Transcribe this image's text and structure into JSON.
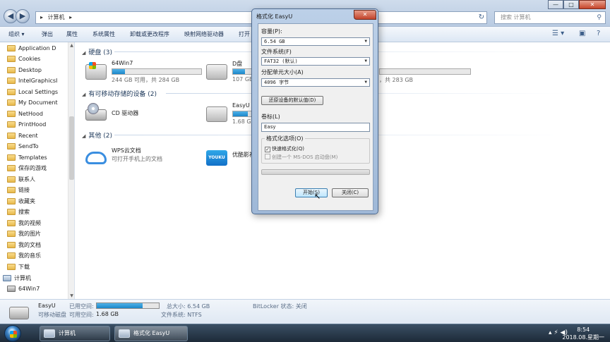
{
  "explorer": {
    "address": {
      "segments": [
        "▸",
        "计算机",
        "▸"
      ]
    },
    "search": {
      "placeholder": "搜索 计算机"
    },
    "window_controls": {
      "minimize": "—",
      "maximize": "□",
      "close": "✕"
    },
    "toolbar": {
      "items": [
        "组织 ▾",
        "弹出",
        "属性",
        "系统属性",
        "卸载或更改程序",
        "映射网络驱动器",
        "打开"
      ],
      "view_icon": "☰ ▾",
      "pane_icon": "▣",
      "help_icon": "?"
    },
    "nav": {
      "items": [
        {
          "label": "Application D"
        },
        {
          "label": "Cookies"
        },
        {
          "label": "Desktop"
        },
        {
          "label": "IntelGraphicsI"
        },
        {
          "label": "Local Settings"
        },
        {
          "label": "My Document"
        },
        {
          "label": "NetHood"
        },
        {
          "label": "PrintHood"
        },
        {
          "label": "Recent"
        },
        {
          "label": "SendTo"
        },
        {
          "label": "Templates"
        },
        {
          "label": "保存的游戏"
        },
        {
          "label": "联系人"
        },
        {
          "label": "链接"
        },
        {
          "label": "收藏夹"
        },
        {
          "label": "搜索"
        },
        {
          "label": "我的视频"
        },
        {
          "label": "我的图片"
        },
        {
          "label": "我的文档"
        },
        {
          "label": "我的音乐"
        },
        {
          "label": "下载"
        }
      ],
      "computer": "计算机",
      "win7": "64Win7"
    },
    "groups": {
      "hdd": "硬盘 (3)",
      "removable": "有可移动存储的设备 (2)",
      "other": "其他 (2)"
    },
    "drives": {
      "win7": {
        "name": "64Win7",
        "info": "244 GB 可用，共 284 GB",
        "used_fraction": 0.14
      },
      "d": {
        "name": "D盘",
        "info": "107 GB",
        "used_fraction": 0.6
      },
      "e": {
        "info": "，共 283 GB"
      },
      "cd": {
        "name": "CD 驱动器"
      },
      "easyu": {
        "name": "EasyU",
        "info": "1.68 GB",
        "used_fraction": 0.74
      },
      "wps": {
        "name": "WPS云文档",
        "info": "可打开手机上的文档"
      },
      "youku": {
        "name": "优酷影视",
        "logo": "YOUKU"
      }
    },
    "details": {
      "name": "EasyU",
      "type": "可移动磁盘",
      "used_label": "已用空间:",
      "free_label": "可用空间:",
      "free_value": "1.68 GB",
      "total": "总大小: 6.54 GB",
      "fs": "文件系统: NTFS",
      "bitlocker": "BitLocker 状态: 关闭",
      "used_fraction": 0.74
    }
  },
  "dialog": {
    "title": "格式化 EasyU",
    "close": "✕",
    "capacity_label": "容量(P):",
    "capacity_value": "6.54 GB",
    "fs_label": "文件系统(F)",
    "fs_value": "FAT32 (默认)",
    "alloc_label": "分配单元大小(A)",
    "alloc_value": "4096 字节",
    "restore_btn": "还原设备的默认值(D)",
    "volume_label": "卷标(L)",
    "volume_value": "Easy",
    "options_legend": "格式化选项(O)",
    "quick_format": "快速格式化(Q)",
    "msdos": "创建一个 MS-DOS 启动盘(M)",
    "start_btn": "开始(S)",
    "close_btn": "关闭(C)"
  },
  "taskbar": {
    "buttons": [
      {
        "label": "计算机"
      },
      {
        "label": "格式化 EasyU"
      }
    ],
    "tray": "▴  ⚡  ◀)",
    "time": "8:54",
    "date": "2018.08.星期一"
  }
}
